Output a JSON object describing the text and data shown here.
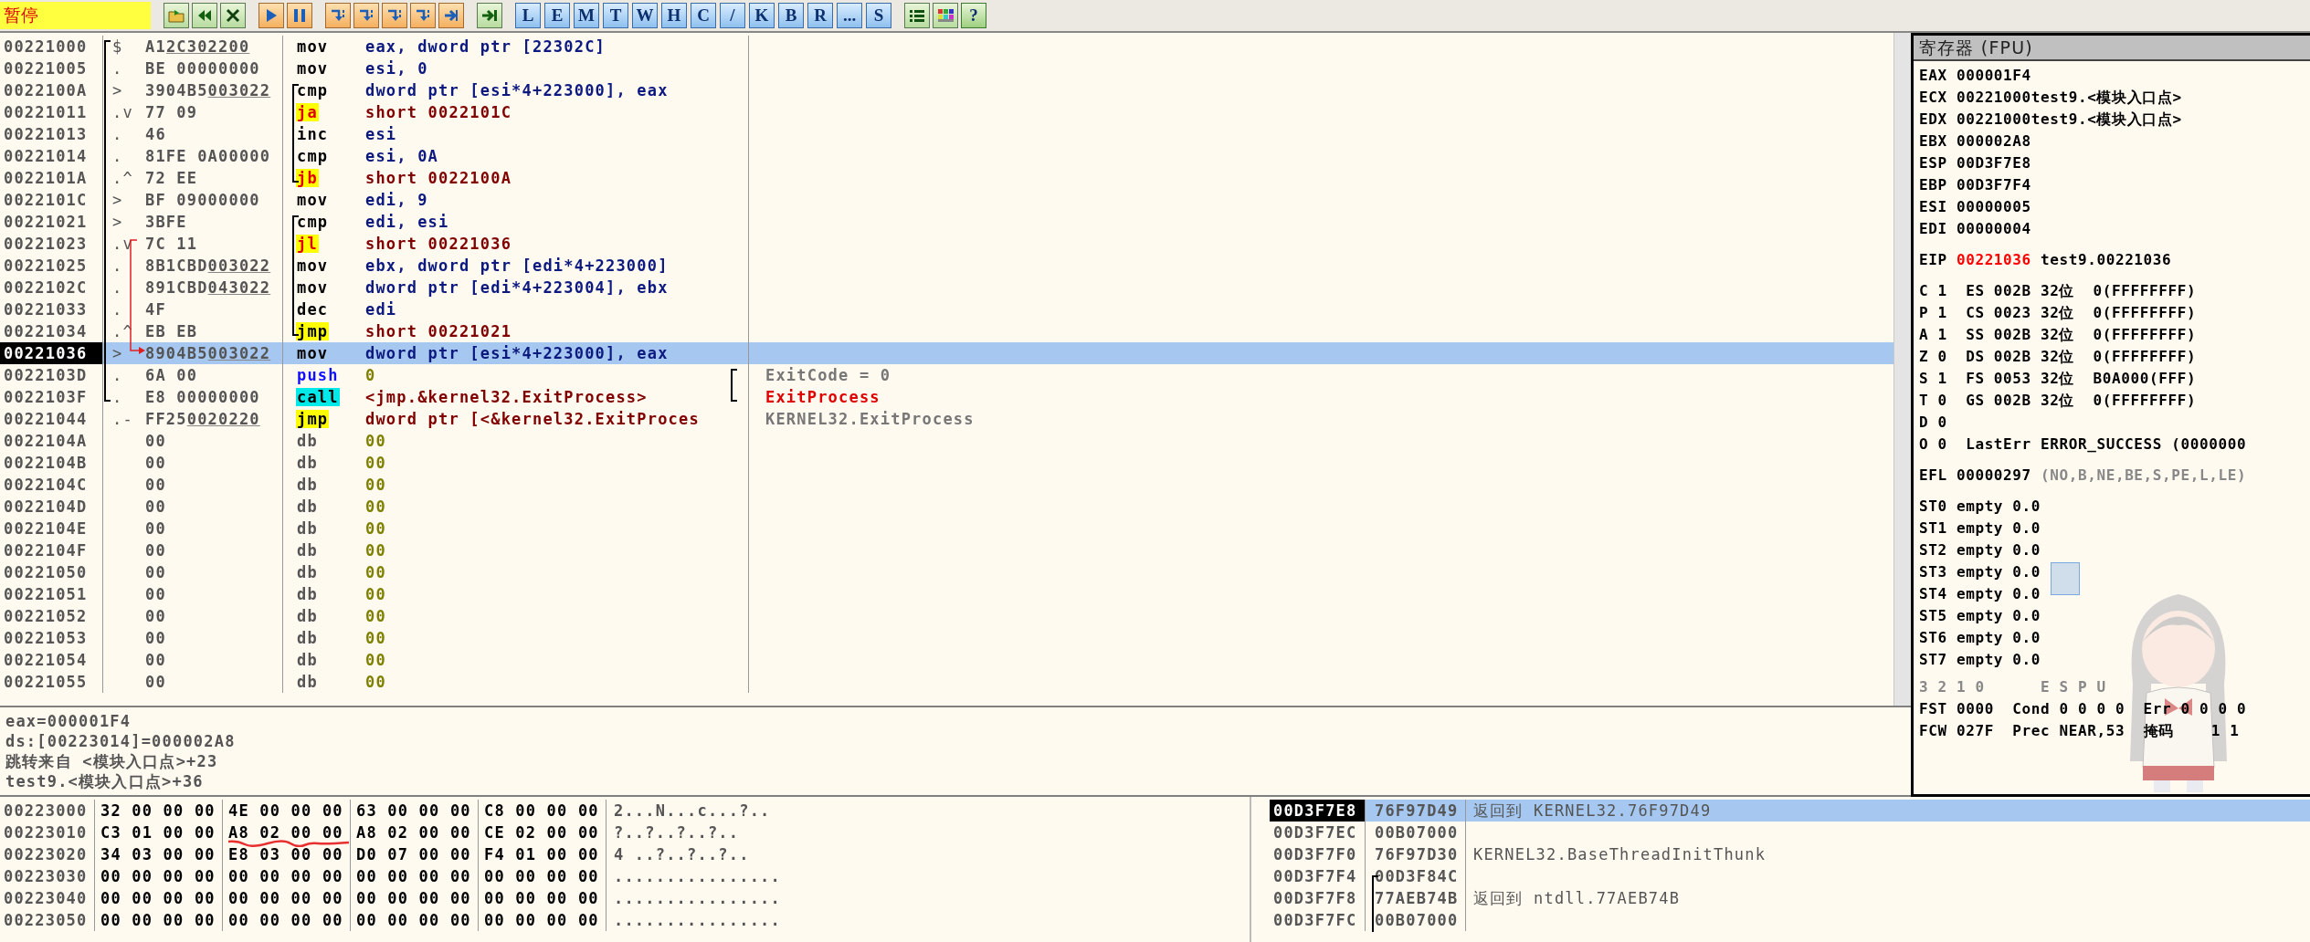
{
  "status": "暂停",
  "letters": [
    "L",
    "E",
    "M",
    "T",
    "W",
    "H",
    "C",
    "/",
    "K",
    "B",
    "R",
    "...",
    "S"
  ],
  "help_button": "?",
  "disasm": [
    {
      "addr": "00221000",
      "mark": "$",
      "hex": "A1",
      "fix": "2C302200",
      "mn": "mov",
      "kind": "plain",
      "ops": "eax, dword ptr [22302C]",
      "selected": false,
      "func_start": true
    },
    {
      "addr": "00221005",
      "mark": ".",
      "hex": "BE 00000000",
      "mn": "mov",
      "kind": "plain",
      "ops": "esi, 0",
      "selected": false
    },
    {
      "addr": "0022100A",
      "mark": ">",
      "hex": "3904B5",
      "fix": "003022",
      "mn": "cmp",
      "kind": "plain",
      "ops": "dword ptr [esi*4+223000], eax",
      "selected": false,
      "loop_start": true
    },
    {
      "addr": "00221011",
      "mark": ".v",
      "hex": "77 09",
      "mn": "ja",
      "kind": "jcc",
      "ops": "short 0022101C",
      "selected": false
    },
    {
      "addr": "00221013",
      "mark": ".",
      "hex": "46",
      "mn": "inc",
      "kind": "plain",
      "ops": "esi",
      "selected": false
    },
    {
      "addr": "00221014",
      "mark": ".",
      "hex": "81FE 0A00000",
      "mn": "cmp",
      "kind": "plain",
      "ops": "esi, 0A",
      "selected": false
    },
    {
      "addr": "0022101A",
      "mark": ".^",
      "hex": "72 EE",
      "mn": "jb",
      "kind": "jcc",
      "ops": "short 0022100A",
      "selected": false,
      "loop_end": true
    },
    {
      "addr": "0022101C",
      "mark": ">",
      "hex": "BF 09000000",
      "mn": "mov",
      "kind": "plain",
      "ops": "edi, 9",
      "selected": false
    },
    {
      "addr": "00221021",
      "mark": ">",
      "hex": "3BFE",
      "mn": "cmp",
      "kind": "plain",
      "ops": "edi, esi",
      "selected": false,
      "loop_start": true
    },
    {
      "addr": "00221023",
      "mark": ".v",
      "hex": "7C 11",
      "mn": "jl",
      "kind": "jcc",
      "ops": "short 00221036",
      "selected": false,
      "jump_from": true
    },
    {
      "addr": "00221025",
      "mark": ".",
      "hex": "8B1CBD",
      "fix": "003022",
      "mn": "mov",
      "kind": "plain",
      "ops": "ebx, dword ptr [edi*4+223000]",
      "selected": false
    },
    {
      "addr": "0022102C",
      "mark": ".",
      "hex": "891CBD",
      "fix": "043022",
      "mn": "mov",
      "kind": "plain",
      "ops": "dword ptr [edi*4+223004], ebx",
      "selected": false
    },
    {
      "addr": "00221033",
      "mark": ".",
      "hex": "4F",
      "mn": "dec",
      "kind": "plain",
      "ops": "edi",
      "selected": false
    },
    {
      "addr": "00221034",
      "mark": ".^",
      "hex": "EB EB",
      "mn": "jmp",
      "kind": "jmp",
      "ops": "short 00221021",
      "selected": false,
      "loop_end": true
    },
    {
      "addr": "00221036",
      "mark": ">",
      "hex": "8904B5",
      "fix": "003022",
      "mn": "mov",
      "kind": "plain",
      "ops": "dword ptr [esi*4+223000], eax",
      "selected": true,
      "jump_to": true
    },
    {
      "addr": "0022103D",
      "mark": ".",
      "hex": "6A 00",
      "mn": "push",
      "kind": "push",
      "ops": "0",
      "comment": "ExitCode = 0",
      "comment_red": false,
      "selected": false,
      "note_start": true
    },
    {
      "addr": "0022103F",
      "mark": ".",
      "hex": "E8 00000000",
      "mn": "call",
      "kind": "call",
      "ops": "<jmp.&kernel32.ExitProcess>",
      "comment": "ExitProcess",
      "comment_red": true,
      "selected": false,
      "func_end": true,
      "note_end": true
    },
    {
      "addr": "00221044",
      "mark": ".-",
      "hex": "FF25",
      "fix": "0020220",
      "mn": "jmp",
      "kind": "jmp",
      "ops": "dword ptr [<&kernel32.ExitProces",
      "comment": "KERNEL32.ExitProcess",
      "comment_red": false,
      "selected": false
    },
    {
      "addr": "0022104A",
      "hex": "00",
      "mn": "db",
      "kind": "data",
      "ops": "00",
      "selected": false
    },
    {
      "addr": "0022104B",
      "hex": "00",
      "mn": "db",
      "kind": "data",
      "ops": "00",
      "selected": false
    },
    {
      "addr": "0022104C",
      "hex": "00",
      "mn": "db",
      "kind": "data",
      "ops": "00",
      "selected": false
    },
    {
      "addr": "0022104D",
      "hex": "00",
      "mn": "db",
      "kind": "data",
      "ops": "00",
      "selected": false
    },
    {
      "addr": "0022104E",
      "hex": "00",
      "mn": "db",
      "kind": "data",
      "ops": "00",
      "selected": false
    },
    {
      "addr": "0022104F",
      "hex": "00",
      "mn": "db",
      "kind": "data",
      "ops": "00",
      "selected": false
    },
    {
      "addr": "00221050",
      "hex": "00",
      "mn": "db",
      "kind": "data",
      "ops": "00",
      "selected": false
    },
    {
      "addr": "00221051",
      "hex": "00",
      "mn": "db",
      "kind": "data",
      "ops": "00",
      "selected": false
    },
    {
      "addr": "00221052",
      "hex": "00",
      "mn": "db",
      "kind": "data",
      "ops": "00",
      "selected": false
    },
    {
      "addr": "00221053",
      "hex": "00",
      "mn": "db",
      "kind": "data",
      "ops": "00",
      "selected": false
    },
    {
      "addr": "00221054",
      "hex": "00",
      "mn": "db",
      "kind": "data",
      "ops": "00",
      "selected": false
    },
    {
      "addr": "00221055",
      "hex": "00",
      "mn": "db",
      "kind": "data",
      "ops": "00",
      "selected": false
    }
  ],
  "info": [
    "eax=000001F4",
    "ds:[00223014]=000002A8",
    "跳转来自 <模块入口点>+23",
    "test9.<模块入口点>+36"
  ],
  "registers": {
    "title": "寄存器 (FPU)",
    "gpr": [
      {
        "name": "EAX",
        "value": "000001F4"
      },
      {
        "name": "ECX",
        "value": "00221000",
        "comment": "test9.<模块入口点>"
      },
      {
        "name": "EDX",
        "value": "00221000",
        "comment": "test9.<模块入口点>"
      },
      {
        "name": "EBX",
        "value": "000002A8"
      },
      {
        "name": "ESP",
        "value": "00D3F7E8"
      },
      {
        "name": "EBP",
        "value": "00D3F7F4"
      },
      {
        "name": "ESI",
        "value": "00000005"
      },
      {
        "name": "EDI",
        "value": "00000004"
      }
    ],
    "eip": {
      "name": "EIP",
      "value": "00221036",
      "changed": true,
      "comment": "test9.00221036"
    },
    "flags": [
      "C 1  ES 002B 32位  0(FFFFFFFF)",
      "P 1  CS 0023 32位  0(FFFFFFFF)",
      "A 1  SS 002B 32位  0(FFFFFFFF)",
      "Z 0  DS 002B 32位  0(FFFFFFFF)",
      "S 1  FS 0053 32位  B0A000(FFF)",
      "T 0  GS 002B 32位  0(FFFFFFFF)",
      "D 0",
      "O 0  LastErr ERROR_SUCCESS (0000000"
    ],
    "efl": {
      "name": "EFL",
      "value": "00000297",
      "decoded": "(NO,B,NE,BE,S,PE,L,LE)"
    },
    "st": [
      "ST0 empty 0.0",
      "ST1 empty 0.0",
      "ST2 empty 0.0",
      "ST3 empty 0.0",
      "ST4 empty 0.0",
      "ST5 empty 0.0",
      "ST6 empty 0.0",
      "ST7 empty 0.0"
    ],
    "fpu_header": "3 2 1 0      E S P U",
    "fst": "FST 0000  Cond 0 0 0 0  Err 0 0 0 0",
    "fcw": "FCW 027F  Prec NEAR,53  掩码    1 1"
  },
  "dump": [
    {
      "addr": "00223000",
      "groups": [
        "32 00 00 00",
        "4E 00 00 00",
        "63 00 00 00",
        "C8 00 00 00"
      ],
      "ascii": "2...N...c...?.."
    },
    {
      "addr": "00223010",
      "groups": [
        "C3 01 00 00",
        "A8 02 00 00",
        "A8 02 00 00",
        "CE 02 00 00"
      ],
      "ascii": "?..?..?..?.."
    },
    {
      "addr": "00223020",
      "groups": [
        "34 03 00 00",
        "E8 03 00 00",
        "D0 07 00 00",
        "F4 01 00 00"
      ],
      "ascii": "4 ..?..?..?.."
    },
    {
      "addr": "00223030",
      "groups": [
        "00 00 00 00",
        "00 00 00 00",
        "00 00 00 00",
        "00 00 00 00"
      ],
      "ascii": "................"
    },
    {
      "addr": "00223040",
      "groups": [
        "00 00 00 00",
        "00 00 00 00",
        "00 00 00 00",
        "00 00 00 00"
      ],
      "ascii": "................"
    },
    {
      "addr": "00223050",
      "groups": [
        "00 00 00 00",
        "00 00 00 00",
        "00 00 00 00",
        "00 00 00 00"
      ],
      "ascii": "................"
    }
  ],
  "stack": [
    {
      "addr": "00D3F7E8",
      "value": "76F97D49",
      "comment": "返回到 KERNEL32.76F97D49",
      "selected": true
    },
    {
      "addr": "00D3F7EC",
      "value": "00B07000",
      "selected": false
    },
    {
      "addr": "00D3F7F0",
      "value": "76F97D30",
      "comment": "KERNEL32.BaseThreadInitThunk",
      "selected": false
    },
    {
      "addr": "00D3F7F4",
      "value": "00D3F84C",
      "selected": false,
      "frame_start": true
    },
    {
      "addr": "00D3F7F8",
      "value": "77AEB74B",
      "comment": "返回到 ntdll.77AEB74B",
      "selected": false
    },
    {
      "addr": "00D3F7FC",
      "value": "00B07000",
      "selected": false
    }
  ]
}
